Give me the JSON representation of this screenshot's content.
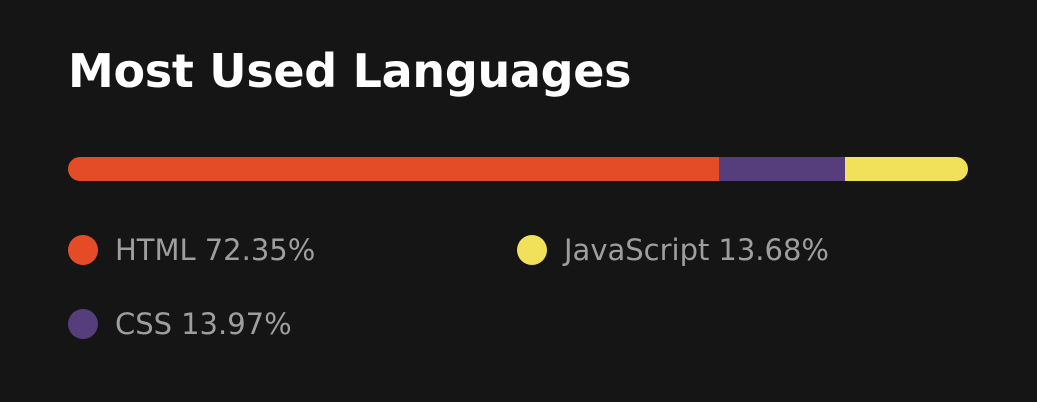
{
  "card": {
    "title": "Most Used Languages"
  },
  "chart_data": {
    "type": "bar",
    "title": "Most Used Languages",
    "categories": [
      "HTML",
      "CSS",
      "JavaScript"
    ],
    "values": [
      72.35,
      13.97,
      13.68
    ],
    "colors": [
      "#e34c26",
      "#563d7c",
      "#f1e05a"
    ],
    "labels": [
      "72.35%",
      "13.97%",
      "13.68%"
    ]
  }
}
